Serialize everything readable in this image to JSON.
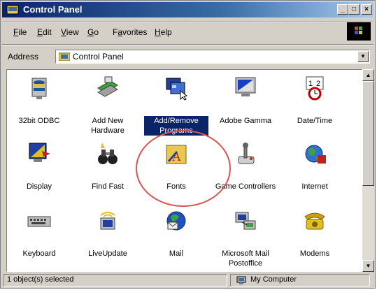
{
  "window": {
    "title": "Control Panel"
  },
  "menu": [
    {
      "label": "File",
      "key": "F",
      "rest": "ile"
    },
    {
      "label": "Edit",
      "key": "E",
      "rest": "dit"
    },
    {
      "label": "View",
      "key": "V",
      "rest": "iew"
    },
    {
      "label": "Go",
      "key": "G",
      "rest": "o"
    },
    {
      "label": "Favorites",
      "pre": "F",
      "key": "a",
      "rest": "vorites"
    },
    {
      "label": "Help",
      "key": "H",
      "rest": "elp"
    }
  ],
  "address": {
    "label": "Address",
    "value": "Control Panel"
  },
  "items": [
    {
      "label": "32bit ODBC",
      "icon": "odbc-icon"
    },
    {
      "label": "Add New Hardware",
      "icon": "add-hardware-icon"
    },
    {
      "label": "Add/Remove Programs",
      "icon": "add-remove-programs-icon",
      "selected": true
    },
    {
      "label": "Adobe Gamma",
      "icon": "monitor-icon"
    },
    {
      "label": "Date/Time",
      "icon": "calendar-clock-icon"
    },
    {
      "label": "Display",
      "icon": "display-icon"
    },
    {
      "label": "Find Fast",
      "icon": "binoculars-icon"
    },
    {
      "label": "Fonts",
      "icon": "fonts-folder-icon"
    },
    {
      "label": "Game Controllers",
      "icon": "joystick-icon"
    },
    {
      "label": "Internet",
      "icon": "globe-icon"
    },
    {
      "label": "Keyboard",
      "icon": "keyboard-icon"
    },
    {
      "label": "LiveUpdate",
      "icon": "liveupdate-icon"
    },
    {
      "label": "Mail",
      "icon": "mail-icon"
    },
    {
      "label": "Microsoft Mail Postoffice",
      "icon": "postoffice-icon"
    },
    {
      "label": "Modems",
      "icon": "phone-icon"
    }
  ],
  "status": {
    "left": "1 object(s) selected",
    "right": "My Computer"
  },
  "colors": {
    "title_start": "#0a246a",
    "title_end": "#a6caf0",
    "selection": "#0a246a",
    "highlight_ring": "#e05050"
  }
}
